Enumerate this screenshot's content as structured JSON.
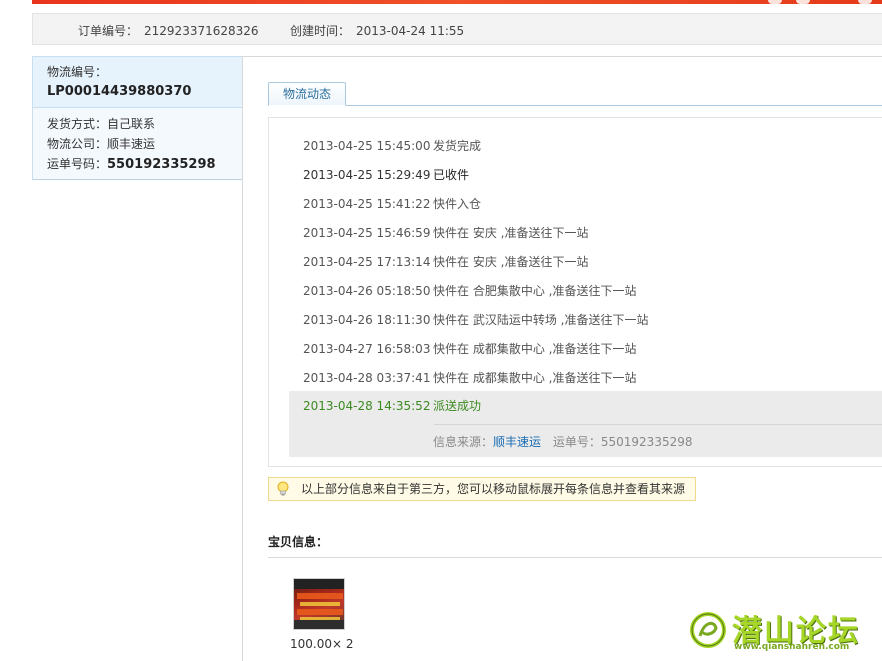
{
  "order": {
    "number_label": "订单编号：",
    "number_value": "212923371628326",
    "created_label": "创建时间：",
    "created_value": "2013-04-24 11:55"
  },
  "logistics": {
    "no_label": "物流编号：",
    "no_value": "LP00014439880370",
    "ship_method": "发货方式：自己联系",
    "company": "物流公司：顺丰速运",
    "waybill_label": "运单号码：",
    "waybill_value": "550192335298"
  },
  "tabs": [
    {
      "label": "物流动态",
      "active": true
    }
  ],
  "track": [
    {
      "time": "2013-04-25 15:45:00",
      "text": "发货完成",
      "emphasis": false
    },
    {
      "time": "2013-04-25 15:29:49",
      "text": "已收件",
      "emphasis": true
    },
    {
      "time": "2013-04-25 15:41:22",
      "text": "快件入仓",
      "emphasis": false
    },
    {
      "time": "2013-04-25 15:46:59",
      "text": "快件在 安庆 ,准备送往下一站",
      "emphasis": false
    },
    {
      "time": "2013-04-25 17:13:14",
      "text": "快件在 安庆 ,准备送往下一站",
      "emphasis": false
    },
    {
      "time": "2013-04-26 05:18:50",
      "text": "快件在 合肥集散中心 ,准备送往下一站",
      "emphasis": false
    },
    {
      "time": "2013-04-26 18:11:30",
      "text": "快件在 武汉陆运中转场 ,准备送往下一站",
      "emphasis": false
    },
    {
      "time": "2013-04-27 16:58:03",
      "text": "快件在 成都集散中心 ,准备送往下一站",
      "emphasis": false
    },
    {
      "time": "2013-04-28 03:37:41",
      "text": "快件在 成都集散中心 ,准备送往下一站",
      "emphasis": false
    }
  ],
  "track_last": {
    "time": "2013-04-28 14:35:52",
    "text": "派送成功"
  },
  "source": {
    "label": "信息来源：",
    "link": "顺丰速运",
    "waybill_label": "运单号：",
    "waybill_value": "550192335298"
  },
  "notice": {
    "icon": "lightbulb-icon",
    "text": "以上部分信息来自于第三方，您可以移动鼠标展开每条信息并查看其来源"
  },
  "item": {
    "title": "宝贝信息：",
    "price_qty": "100.00× 2"
  },
  "watermark": {
    "text": "潜山论坛",
    "url": "www.qianshanren.com"
  },
  "colors": {
    "accent_red": "#e8341c",
    "link_blue": "#1a6cb4",
    "success_green": "#3b8a20",
    "panel_blue": "#eef6fd"
  }
}
